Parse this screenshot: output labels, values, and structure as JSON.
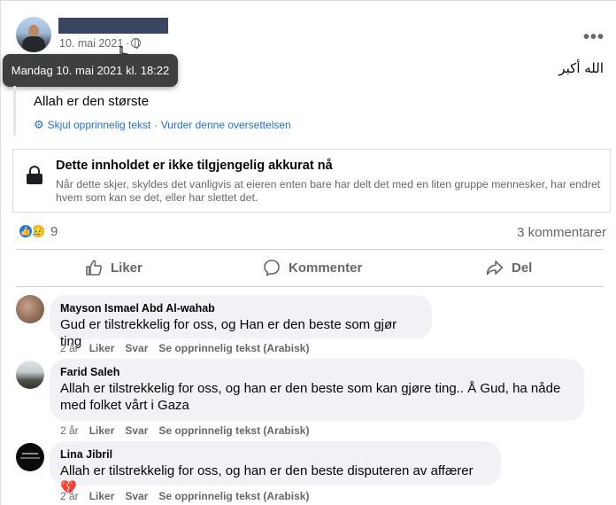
{
  "post": {
    "date": "10. mai 2021",
    "tooltip": "Mandag 10. mai 2021 kl. 18:22",
    "arabic_text": "الله أكبر",
    "translation": "Allah er den største",
    "hide_original": "Skjul opprinnelig tekst",
    "rate_translation": "· Vurder denne oversettelsen",
    "more_icon": "more-icon"
  },
  "unavailable": {
    "title": "Dette innholdet er ikke tilgjengelig akkurat nå",
    "text": "Når dette skjer, skyldes det vanligvis at eieren enten bare har delt det med en liten gruppe mennesker, har endret hvem som kan se det, eller har slettet det."
  },
  "reactions": {
    "count": "9",
    "comments_count": "3 kommentarer",
    "types": [
      "like",
      "sad"
    ]
  },
  "actions": {
    "like": "Liker",
    "comment": "Kommenter",
    "share": "Del"
  },
  "comments": [
    {
      "name": "Mayson Ismael Abd Al-wahab",
      "text": "Gud er tilstrekkelig for oss, og Han er den beste som gjør ting",
      "time": "2 år",
      "like": "Liker",
      "reply": "Svar",
      "see_original": "Se opprinnelig tekst (Arabisk)"
    },
    {
      "name": "Farid Saleh",
      "text": "Allah er tilstrekkelig for oss, og han er den beste som kan gjøre ting.. Å Gud, ha nåde med folket vårt i Gaza",
      "time": "2 år",
      "like": "Liker",
      "reply": "Svar",
      "see_original": "Se opprinnelig tekst (Arabisk)"
    },
    {
      "name": "Lina Jibril",
      "text": "Allah er tilstrekkelig for oss, og han er den beste disputeren av affærer 💔",
      "time": "2 år",
      "like": "Liker",
      "reply": "Svar",
      "see_original": "Se opprinnelig tekst (Arabisk)"
    }
  ],
  "colors": {
    "link": "#216fdb",
    "secondary_text": "#65676b",
    "bubble": "#f0f2f5",
    "like_blue": "#1877f2"
  }
}
